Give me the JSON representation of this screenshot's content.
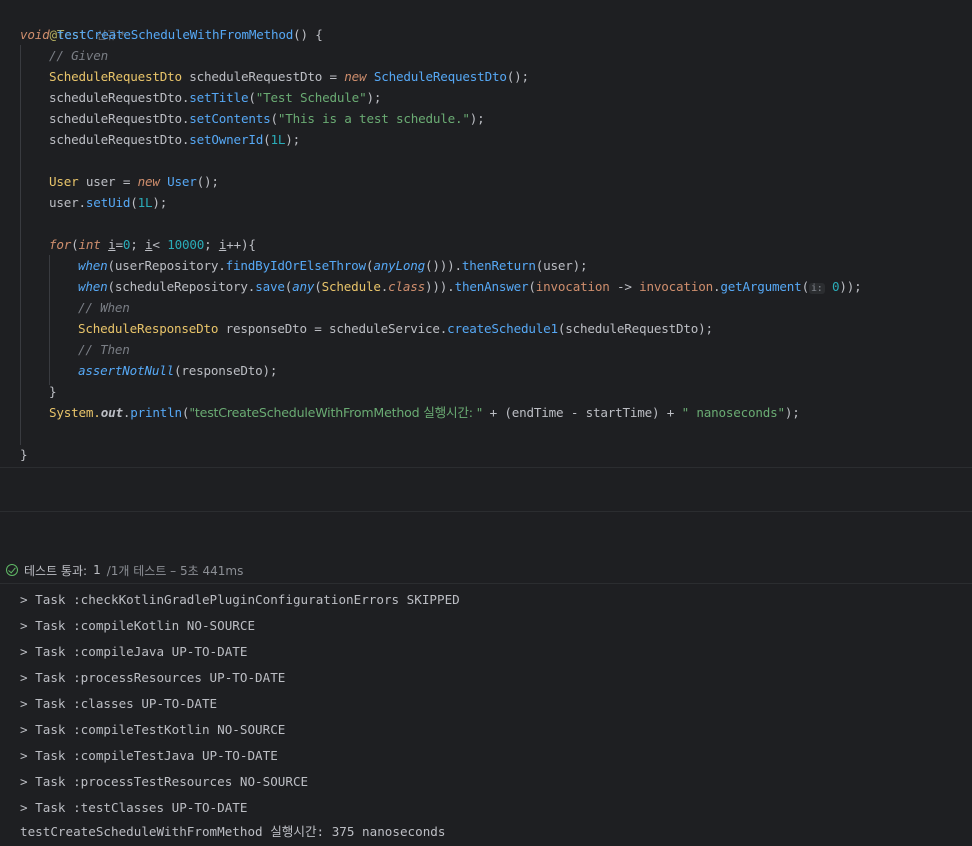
{
  "editor": {
    "annotation": "@Test",
    "annotation_hint": "신규 *",
    "method_signature": {
      "keyword": "void",
      "name": "testCreateScheduleWithFromMethod",
      "rest": "() {"
    },
    "comments": {
      "given": "// Given",
      "when": "// When",
      "then": "// Then"
    },
    "line_dto_decl": {
      "type": "ScheduleRequestDto",
      "var": " scheduleRequestDto = ",
      "kw_new": "new",
      "ctor": " ScheduleRequestDto",
      "end": "();"
    },
    "line_set_title": {
      "recv": "scheduleRequestDto.",
      "call": "setTitle",
      "open": "(",
      "arg": "\"Test Schedule\"",
      "close": ");"
    },
    "line_set_contents": {
      "recv": "scheduleRequestDto.",
      "call": "setContents",
      "open": "(",
      "arg": "\"This is a test schedule.\"",
      "close": ");"
    },
    "line_set_owner": {
      "recv": "scheduleRequestDto.",
      "call": "setOwnerId",
      "open": "(",
      "arg": "1L",
      "close": ");"
    },
    "line_user_decl": {
      "type": "User",
      "var": " user = ",
      "kw_new": "new",
      "ctor": " User",
      "end": "();"
    },
    "line_set_uid": {
      "recv": "user.",
      "call": "setUid",
      "open": "(",
      "arg": "1L",
      "close": ");"
    },
    "line_for": {
      "kw_for": "for",
      "open": "(",
      "kw_int": "int",
      "sp": " ",
      "var_i": "i",
      "eq": "=",
      "zero": "0",
      "semi": "; ",
      "lt": "< ",
      "limit": "10000",
      "semi2": "; ",
      "inc": "++){"
    },
    "line_when_user": {
      "fn_when": "when",
      "open": "(userRepository.",
      "call": "findByIdOrElseThrow",
      "open2": "(",
      "any": "anyLong",
      "close": "())).",
      "then": "thenReturn",
      "tail": "(user);"
    },
    "line_when_schedule": {
      "fn_when": "when",
      "open": "(scheduleRepository.",
      "call": "save",
      "open2": "(",
      "any": "any",
      "open3": "(",
      "cls": "Schedule",
      "dot": ".",
      "kw_class": "class",
      "close": "))).",
      "then": "thenAnswer",
      "open4": "(",
      "param": "invocation",
      "arrow": " -> ",
      "param2": "invocation",
      "dot2": ".",
      "getarg": "getArgument",
      "open5": "(",
      "inlay": "i:",
      "zero": " 0",
      "close2": "));"
    },
    "line_response": {
      "type": "ScheduleResponseDto",
      "var": " responseDto = scheduleService.",
      "call": "createSchedule1",
      "tail": "(scheduleRequestDto);"
    },
    "line_assert": {
      "fn": "assertNotNull",
      "tail": "(responseDto);"
    },
    "brace_close_loop": "}",
    "line_println": {
      "cls": "System.",
      "out": "out",
      "dot": ".",
      "call": "println",
      "open": "(",
      "str1": "\"testCreateScheduleWithFromMethod 실행시간: \"",
      "mid": " + (endTime - startTime) + ",
      "str2": "\" nanoseconds\"",
      "close": ");"
    },
    "brace_close_method": "}"
  },
  "test_bar": {
    "status_label": "테스트 통과:",
    "passed_count": "1",
    "meta": "/1개 테스트 – 5초 441ms"
  },
  "console": {
    "lines": [
      "> Task :checkKotlinGradlePluginConfigurationErrors SKIPPED",
      "> Task :compileKotlin NO-SOURCE",
      "> Task :compileJava UP-TO-DATE",
      "> Task :processResources UP-TO-DATE",
      "> Task :classes UP-TO-DATE",
      "> Task :compileTestKotlin NO-SOURCE",
      "> Task :compileTestJava UP-TO-DATE",
      "> Task :processTestResources NO-SOURCE",
      "> Task :testClasses UP-TO-DATE",
      "testCreateScheduleWithFromMethod 실행시간: 375 nanoseconds"
    ]
  },
  "colors": {
    "background": "#1e1f22",
    "keyword": "#cf8e6d",
    "function": "#56a8f5",
    "string": "#6aab73",
    "number": "#2aacb8",
    "type": "#e8c46a",
    "comment": "#7a7e85",
    "success": "#5fb865"
  }
}
